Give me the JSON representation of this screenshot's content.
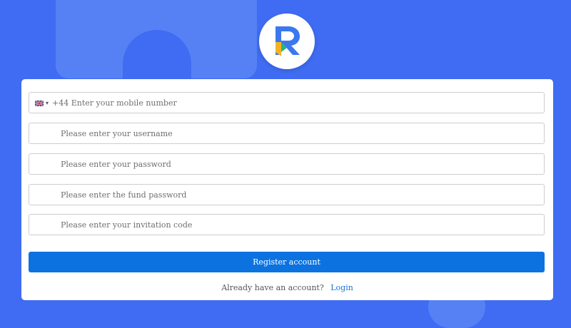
{
  "colors": {
    "background": "#3f6cf2",
    "accent": "#0b72e0",
    "link": "#1a73d9"
  },
  "logo": {
    "icon": "r-letter-logo-icon"
  },
  "form": {
    "phone": {
      "country_flag_icon": "uk-flag-icon",
      "dropdown_icon": "caret-down-icon",
      "placeholder": "+44 Enter your mobile number"
    },
    "username": {
      "placeholder": "Please enter your username"
    },
    "password": {
      "placeholder": "Please enter your password"
    },
    "fund_password": {
      "placeholder": "Please enter the fund password"
    },
    "invitation_code": {
      "placeholder": "Please enter your invitation code"
    },
    "register_label": "Register account",
    "login_prompt": "Already have an account?",
    "login_link": "Login"
  }
}
